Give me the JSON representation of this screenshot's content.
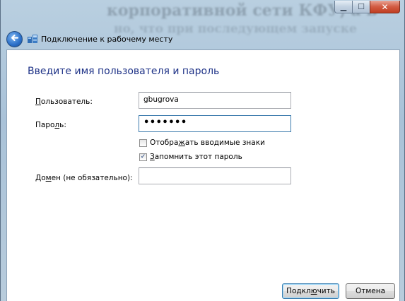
{
  "background_text": {
    "line1": "корпоративной сети КФУ, а в",
    "line2": "но, что при последующем запуске"
  },
  "window": {
    "title": "Подключение к рабочему месту",
    "caption_buttons": {
      "minimize": "▁",
      "maximize": "☐",
      "close": "✕"
    }
  },
  "dialog": {
    "heading": "Введите имя пользователя и пароль",
    "username": {
      "label_pre": "",
      "label_mnemonic": "П",
      "label_post": "ользователь:",
      "value": "gbugrova"
    },
    "password": {
      "label_pre": "Паро",
      "label_mnemonic": "л",
      "label_post": "ь:",
      "value": "•••••••"
    },
    "show_chars": {
      "label_pre": "Отобра",
      "label_mnemonic": "ж",
      "label_post": "ать вводимые знаки",
      "checked": false
    },
    "remember_password": {
      "label_pre": "",
      "label_mnemonic": "З",
      "label_post": "апомнить этот пароль",
      "checked": true,
      "check_glyph": "✓"
    },
    "domain": {
      "label_pre": "До",
      "label_mnemonic": "м",
      "label_post": "ен (не обязательно):",
      "value": ""
    },
    "connect_button": {
      "label_pre": "Подкл",
      "label_mnemonic": "ю",
      "label_post": "чить"
    },
    "cancel_button": {
      "label": "Отмена"
    }
  },
  "icons": {
    "back": "back-arrow-icon",
    "app": "workplace-connection-icon"
  },
  "colors": {
    "heading": "#1e3287",
    "accent": "#3d7bad"
  }
}
